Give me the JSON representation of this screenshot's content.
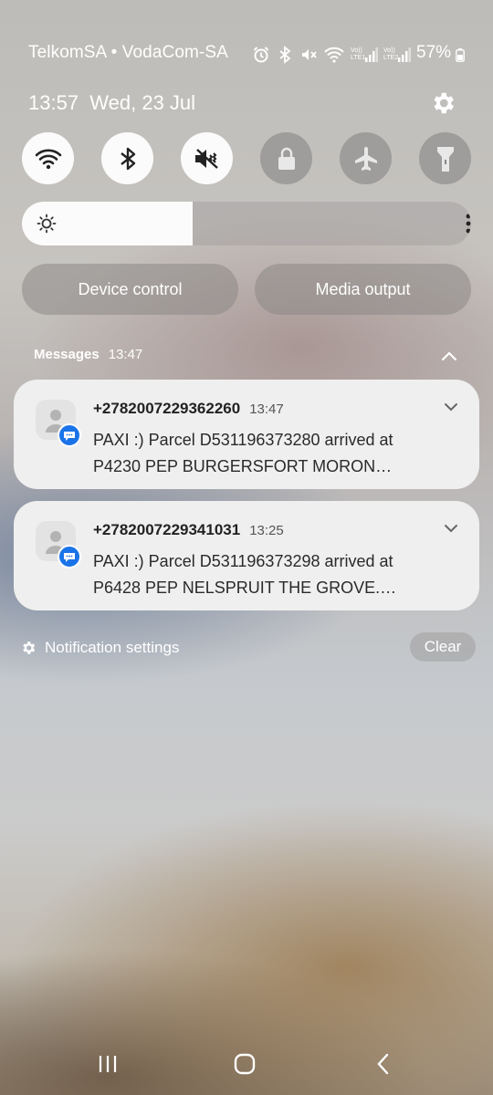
{
  "status_bar": {
    "carrier": "TelkomSA • VodaCom-SA",
    "icons": [
      "alarm-icon",
      "bluetooth-icon",
      "mute-icon",
      "wifi-icon",
      "signal-lte1-icon",
      "signal-lte2-icon"
    ],
    "lte1_label": "Vo)) LTE1",
    "lte2_label": "Vo)) LTE2",
    "battery": "57%"
  },
  "header": {
    "datetime": "13:57  Wed, 23 Jul"
  },
  "quick_settings": [
    {
      "name": "wifi",
      "state": "on",
      "icon": "wifi-icon"
    },
    {
      "name": "bluetooth",
      "state": "on",
      "icon": "bluetooth-icon"
    },
    {
      "name": "sound",
      "state": "on",
      "icon": "mute-icon"
    },
    {
      "name": "rotation-lock",
      "state": "off",
      "icon": "lock-icon"
    },
    {
      "name": "airplane",
      "state": "off",
      "icon": "airplane-icon"
    },
    {
      "name": "flashlight",
      "state": "off",
      "icon": "flashlight-icon"
    }
  ],
  "brightness": {
    "level": 0.38
  },
  "buttons": {
    "device_control": "Device control",
    "media_output": "Media output"
  },
  "messages_group": {
    "app": "Messages",
    "time": "13:47",
    "notifications": [
      {
        "sender": "+2782007229362260",
        "time": "13:47",
        "body": "PAXI :) Parcel D531196373280 arrived at P4230 PEP BURGERSFORT MORON…"
      },
      {
        "sender": "+2782007229341031",
        "time": "13:25",
        "body": "PAXI :) Parcel D531196373298 arrived at P6428 PEP NELSPRUIT THE GROVE.…"
      }
    ]
  },
  "footer": {
    "notification_settings": "Notification settings",
    "clear": "Clear"
  },
  "colors": {
    "accent": "#1a73e8",
    "card": "#efefef",
    "tile_on": "#fbfbfb"
  }
}
